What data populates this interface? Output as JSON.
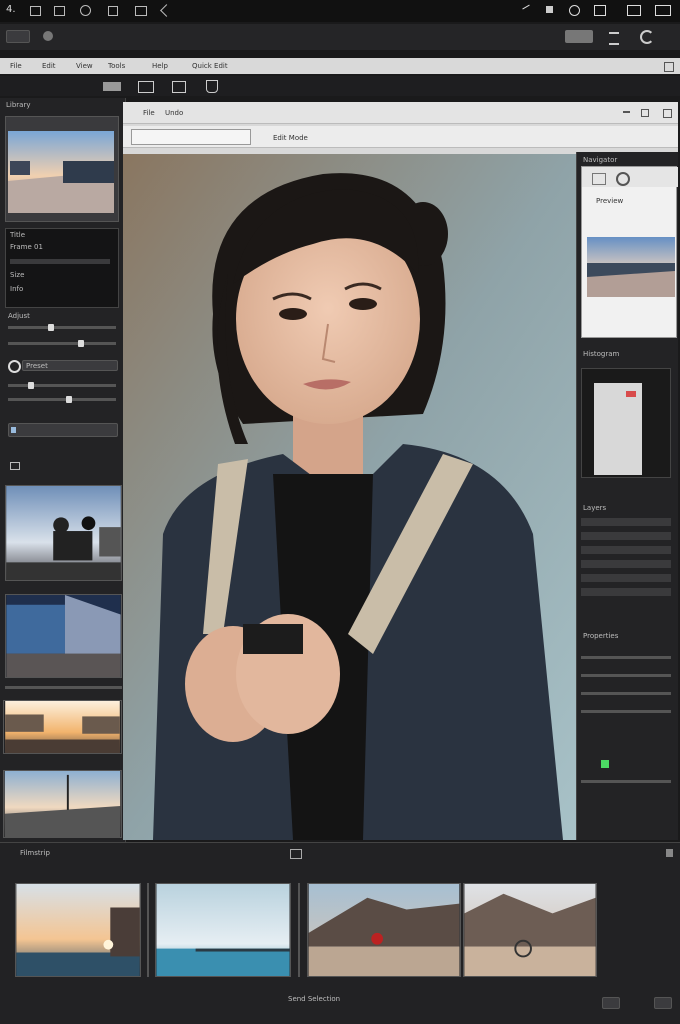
{
  "system_bar": {
    "left_label": "4.",
    "right_icons": [
      "pen-icon",
      "settings-icon",
      "document-icon",
      "window-icon",
      "maximize-icon"
    ]
  },
  "app_toolbar": {
    "buttons": [
      "menu",
      "record"
    ],
    "right_buttons": [
      "view",
      "list",
      "refresh"
    ]
  },
  "menu_strip": {
    "items": [
      "File",
      "Edit",
      "View",
      "Tools",
      "Help"
    ],
    "extra": "Quick Edit"
  },
  "tool_row": {
    "tools": [
      "panel",
      "frame",
      "select",
      "lasso"
    ]
  },
  "left_panel": {
    "header": "Library",
    "meta_lines": [
      "Title",
      "Frame 01",
      "Size",
      "Info"
    ],
    "section_label": "Adjust",
    "preset_label": "Preset"
  },
  "canvas_toolbar": {
    "items": [
      "File",
      "Undo"
    ],
    "path": "Edit Mode"
  },
  "right_panel": {
    "header": "Navigator",
    "preview_title": "Preview",
    "histogram_label": "Histogram",
    "layers_label": "Layers",
    "props_label": "Properties"
  },
  "filmstrip": {
    "header": "Filmstrip",
    "footer_text": "Send Selection"
  },
  "colors": {
    "bg": "#1a1a1b",
    "panel": "#2a2a2c",
    "light_bar": "#d9d9d9",
    "accent": "#4cd964"
  }
}
